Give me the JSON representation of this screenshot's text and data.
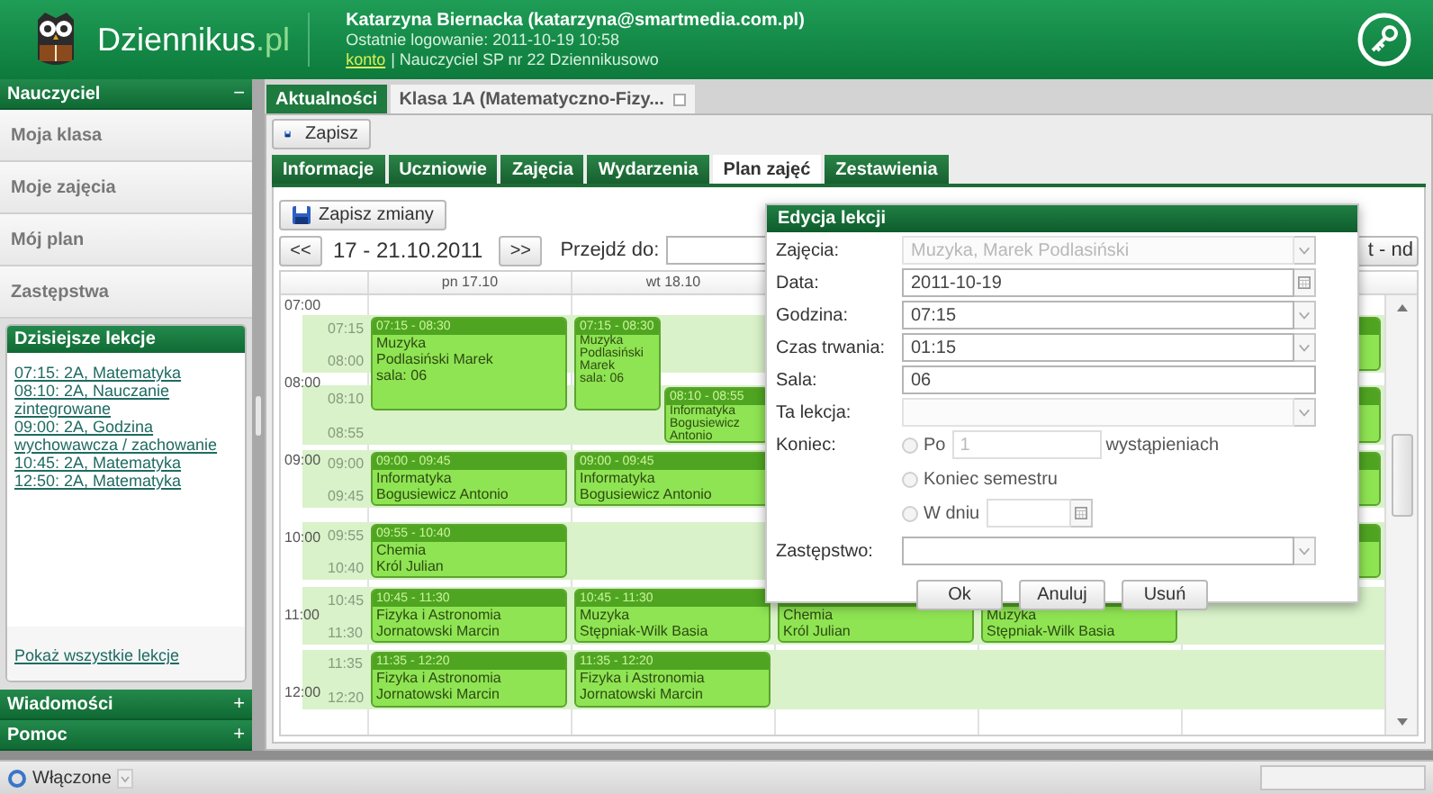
{
  "header": {
    "logo": "Dziennikus",
    "logo_suffix": ".pl",
    "user": "Katarzyna Biernacka (katarzyna@smartmedia.com.pl)",
    "last_login": "Ostatnie logowanie: 2011-10-19 10:58",
    "account_link": "konto",
    "school": "| Nauczyciel SP nr 22 Dziennikusowo"
  },
  "sidebar": {
    "title": "Nauczyciel",
    "toggle": "−",
    "items": [
      {
        "label": "Moja klasa"
      },
      {
        "label": "Moje zajęcia"
      },
      {
        "label": "Mój plan"
      },
      {
        "label": "Zastępstwa"
      }
    ],
    "today": {
      "title": "Dzisiejsze lekcje",
      "lessons": [
        "07:15: 2A, Matematyka",
        "08:10: 2A, Nauczanie zintegrowane",
        "09:00: 2A, Godzina wychowawcza / zachowanie",
        "10:45: 2A, Matematyka",
        "12:50: 2A, Matematyka"
      ],
      "more": "Pokaż wszystkie lekcje"
    },
    "sections": [
      {
        "label": "Wiadomości",
        "toggle": "+"
      },
      {
        "label": "Pomoc",
        "toggle": "+"
      }
    ]
  },
  "main_tabs": [
    {
      "label": "Aktualności",
      "selected": false,
      "closable": false
    },
    {
      "label": "Klasa 1A (Matematyczno-Fizy...",
      "selected": true,
      "closable": true
    }
  ],
  "toolbar": {
    "save": "Zapisz"
  },
  "sub_tabs": [
    {
      "label": "Informacje",
      "selected": false
    },
    {
      "label": "Uczniowie",
      "selected": false
    },
    {
      "label": "Zajęcia",
      "selected": false
    },
    {
      "label": "Wydarzenia",
      "selected": false
    },
    {
      "label": "Plan zajęć",
      "selected": true
    },
    {
      "label": "Zestawienia",
      "selected": false
    }
  ],
  "schedule": {
    "save_changes": "Zapisz zmiany",
    "prev": "<<",
    "range": "17 - 21.10.2011",
    "next": ">>",
    "goto_label": "Przejdź do:",
    "view_button": "t - nd",
    "days": [
      "pn 17.10",
      "wt 18.10"
    ],
    "hours": [
      "07:00",
      "08:00",
      "09:00",
      "10:00",
      "11:00",
      "12:00"
    ],
    "rows": [
      {
        "start": "07:15",
        "end": "08:00",
        "cells": [
          [
            {
              "time": "07:15 - 08:30",
              "subject": "Muzyka",
              "teacher": "Podlasiński Marek",
              "room": "sala: 06"
            }
          ],
          [
            {
              "time": "07:15 - 08:30",
              "subject": "Muzyka",
              "teacher": "Podlasiński Marek",
              "room": "sala: 06"
            }
          ],
          [],
          [],
          [
            {}
          ]
        ]
      },
      {
        "start": "08:10",
        "end": "08:55",
        "cells": [
          [],
          [
            {
              "time": "08:10 - 08:55",
              "subject": "Informatyka",
              "teacher": "Bogusiewicz Antonio"
            }
          ],
          [],
          [],
          [
            {}
          ]
        ]
      },
      {
        "start": "09:00",
        "end": "09:45",
        "cells": [
          [
            {
              "time": "09:00 - 09:45",
              "subject": "Informatyka",
              "teacher": "Bogusiewicz Antonio"
            }
          ],
          [
            {
              "time": "09:00 - 09:45",
              "subject": "Informatyka",
              "teacher": "Bogusiewicz Antonio"
            }
          ],
          [],
          [],
          [
            {}
          ]
        ]
      },
      {
        "start": "09:55",
        "end": "10:40",
        "cells": [
          [
            {
              "time": "09:55 - 10:40",
              "subject": "Chemia",
              "teacher": "Król Julian"
            }
          ],
          [],
          [],
          [],
          [
            {}
          ]
        ]
      },
      {
        "start": "10:45",
        "end": "11:30",
        "cells": [
          [
            {
              "time": "10:45 - 11:30",
              "subject": "Fizyka i Astronomia",
              "teacher": "Jornatowski Marcin"
            }
          ],
          [
            {
              "time": "10:45 - 11:30",
              "subject": "Muzyka",
              "teacher": "Stępniak-Wilk Basia"
            }
          ],
          [
            {
              "subject": "Chemia",
              "teacher": "Król Julian"
            }
          ],
          [
            {
              "subject": "Muzyka",
              "teacher": "Stępniak-Wilk Basia"
            }
          ],
          []
        ]
      },
      {
        "start": "11:35",
        "end": "12:20",
        "cells": [
          [
            {
              "time": "11:35 - 12:20",
              "subject": "Fizyka i Astronomia",
              "teacher": "Jornatowski Marcin"
            }
          ],
          [
            {
              "time": "11:35 - 12:20",
              "subject": "Fizyka i Astronomia",
              "teacher": "Jornatowski Marcin"
            }
          ],
          [],
          [],
          []
        ]
      }
    ]
  },
  "dialog": {
    "title": "Edycja lekcji",
    "fields": [
      {
        "kind": "select",
        "label": "Zajęcia:",
        "value": "Muzyka, Marek Podlasiński",
        "disabled": true
      },
      {
        "kind": "date",
        "label": "Data:",
        "value": "2011-10-19",
        "disabled": false
      },
      {
        "kind": "select",
        "label": "Godzina:",
        "value": "07:15",
        "disabled": false
      },
      {
        "kind": "select",
        "label": "Czas trwania:",
        "value": "01:15",
        "disabled": false
      },
      {
        "kind": "text",
        "label": "Sala:",
        "value": "06",
        "disabled": false
      },
      {
        "kind": "select",
        "label": "Ta lekcja:",
        "disabled": true
      }
    ],
    "end": {
      "label": "Koniec:",
      "options": [
        {
          "kind": "count",
          "label": "Po",
          "value": "1",
          "suffix": "wystąpieniach",
          "selected": false
        },
        {
          "kind": "plain",
          "label": "Koniec semestru",
          "selected": false
        },
        {
          "kind": "date",
          "label": "W dniu",
          "selected": false
        }
      ]
    },
    "substitute": {
      "kind": "select",
      "label": "Zastępstwo:",
      "disabled": false
    },
    "buttons": [
      "Ok",
      "Anuluj",
      "Usuń"
    ]
  },
  "status_bar": {
    "label": "Włączone"
  }
}
